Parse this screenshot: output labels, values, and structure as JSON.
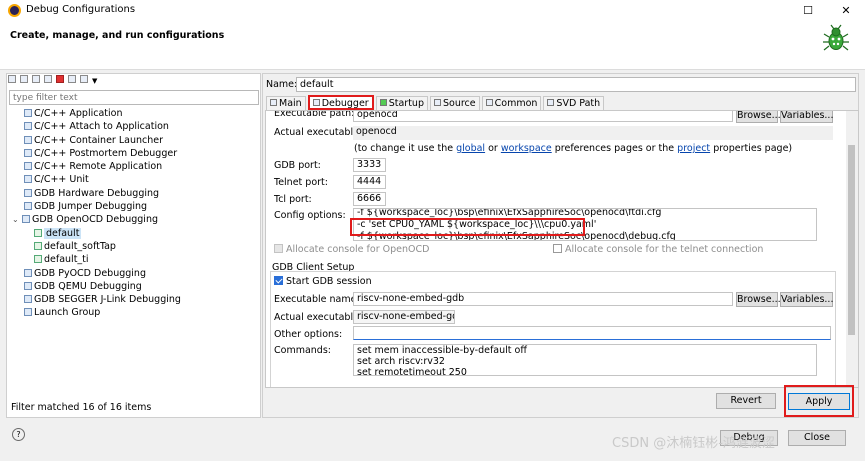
{
  "window": {
    "title": "Debug Configurations",
    "header": "Create, manage, and run configurations"
  },
  "left": {
    "filter_placeholder": "type filter text",
    "tree": [
      {
        "label": "C/C++ Application",
        "level": 0
      },
      {
        "label": "C/C++ Attach to Application",
        "level": 0
      },
      {
        "label": "C/C++ Container Launcher",
        "level": 0
      },
      {
        "label": "C/C++ Postmortem Debugger",
        "level": 0
      },
      {
        "label": "C/C++ Remote Application",
        "level": 0
      },
      {
        "label": "C/C++ Unit",
        "level": 0
      },
      {
        "label": "GDB Hardware Debugging",
        "level": 0
      },
      {
        "label": "GDB Jumper Debugging",
        "level": 0
      },
      {
        "label": "GDB OpenOCD Debugging",
        "level": 0,
        "expanded": true
      },
      {
        "label": "default",
        "level": 1,
        "selected": true
      },
      {
        "label": "default_softTap",
        "level": 1
      },
      {
        "label": "default_ti",
        "level": 1
      },
      {
        "label": "GDB PyOCD Debugging",
        "level": 0
      },
      {
        "label": "GDB QEMU Debugging",
        "level": 0
      },
      {
        "label": "GDB SEGGER J-Link Debugging",
        "level": 0
      },
      {
        "label": "Launch Group",
        "level": 0
      }
    ],
    "status": "Filter matched 16 of 16 items"
  },
  "right": {
    "name_label": "Name:",
    "name_value": "default",
    "tabs": [
      {
        "label": "Main",
        "icon": "main-tab-icon"
      },
      {
        "label": "Debugger",
        "icon": "debugger-tab-icon",
        "active": true
      },
      {
        "label": "Startup",
        "icon": "startup-tab-icon"
      },
      {
        "label": "Source",
        "icon": "source-tab-icon"
      },
      {
        "label": "Common",
        "icon": "common-tab-icon"
      },
      {
        "label": "SVD Path",
        "icon": "svd-tab-icon"
      }
    ],
    "openocd": {
      "exec_path_label": "Executable path:",
      "exec_path_value": "openocd",
      "browse": "Browse...",
      "variables": "Variables...",
      "actual_label": "Actual executable:",
      "actual_value": "openocd",
      "hint_prefix": "(to change it use the",
      "hint_global": "global",
      "hint_or": "or",
      "hint_workspace": "workspace",
      "hint_mid": "preferences pages or the",
      "hint_project": "project",
      "hint_suffix": "properties page)",
      "gdb_port_label": "GDB port:",
      "gdb_port": "3333",
      "telnet_port_label": "Telnet port:",
      "telnet_port": "4444",
      "tcl_port_label": "Tcl port:",
      "tcl_port": "6666",
      "config_label": "Config options:",
      "config_line1": "-f ${workspace_loc}\\bsp\\efinix\\EfxSapphireSoc\\openocd\\ftdi.cfg",
      "config_line2": "-c 'set CPU0_YAML ${workspace_loc}\\\\\\cpu0.yaml'",
      "config_line3": "-f ${workspace_loc}\\bsp\\efinix\\EfxSapphireSoc\\openocd\\debug.cfg",
      "alloc_console": "Allocate console for OpenOCD",
      "alloc_telnet": "Allocate console for the telnet connection"
    },
    "gdb_client": {
      "group_title": "GDB Client Setup",
      "start_session": "Start GDB session",
      "exec_name_label": "Executable name:",
      "exec_name_value": "riscv-none-embed-gdb",
      "browse": "Browse...",
      "variables": "Variables...",
      "actual_label": "Actual executable:",
      "actual_value": "riscv-none-embed-gdb",
      "other_label": "Other options:",
      "other_value": "",
      "commands_label": "Commands:",
      "commands": [
        "set mem inaccessible-by-default off",
        "set arch riscv:rv32",
        "set remotetimeout 250"
      ]
    },
    "revert": "Revert",
    "apply": "Apply"
  },
  "bottom": {
    "debug": "Debug",
    "close": "Close",
    "help_icon": "help-icon"
  },
  "watermark": "CSDN @沐楠钰彬-鸿涟波涩",
  "colors": {
    "highlight_box": "#e01b1b",
    "selection": "#cce4f7",
    "link": "#0645ad"
  }
}
